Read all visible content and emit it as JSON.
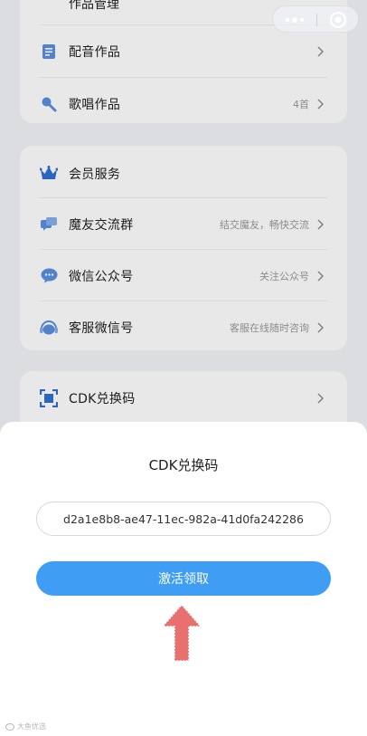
{
  "top_card": {
    "partial_title": "作品管理",
    "items": [
      {
        "label": "配音作品",
        "meta": "",
        "icon": "document-icon"
      },
      {
        "label": "歌唱作品",
        "meta": "4首",
        "icon": "microphone-icon"
      }
    ]
  },
  "member_card": {
    "title": "会员服务",
    "title_icon": "crown-icon",
    "items": [
      {
        "label": "魔友交流群",
        "meta": "结交魔友，畅快交流",
        "icon": "group-chat-icon"
      },
      {
        "label": "微信公众号",
        "meta": "关注公众号",
        "icon": "wechat-icon"
      },
      {
        "label": "客服微信号",
        "meta": "客服在线随时咨询",
        "icon": "headset-icon"
      }
    ]
  },
  "cdk_card": {
    "label": "CDK兑换码",
    "icon": "scan-frame-icon"
  },
  "dialog": {
    "title": "CDK兑换码",
    "code_value": "d2a1e8b8-ae47-11ec-982a-41d0fa242286",
    "button_label": "激活领取"
  },
  "watermark": {
    "text": "大鱼优选"
  },
  "colors": {
    "accent_blue": "#3f9df3",
    "icon_blue": "#2f6fd6",
    "arrow_red": "#e8706e"
  }
}
